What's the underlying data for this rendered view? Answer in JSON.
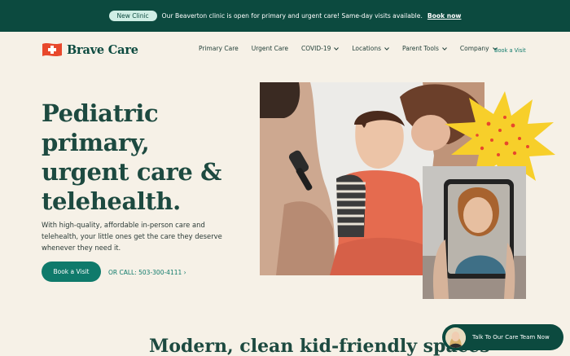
{
  "announcement": {
    "badge": "New Clinic",
    "text": "Our Beaverton clinic is open for primary and urgent care! Same-day visits available.",
    "link": "Book now"
  },
  "brand": {
    "name": "Brave Care"
  },
  "nav": {
    "items": [
      {
        "label": "Primary Care",
        "has_dropdown": false
      },
      {
        "label": "Urgent Care",
        "has_dropdown": false
      },
      {
        "label": "COVID-19",
        "has_dropdown": true
      },
      {
        "label": "Locations",
        "has_dropdown": true
      },
      {
        "label": "Parent Tools",
        "has_dropdown": true
      },
      {
        "label": "Company",
        "has_dropdown": true
      }
    ],
    "cta": "Book a Visit"
  },
  "hero": {
    "title_lines": [
      "Pediatric",
      "primary,",
      "urgent care &",
      "telehealth."
    ],
    "subtitle": "With high-quality, affordable in-person care and telehealth, your little ones get the care they deserve whenever they need it.",
    "primary_button": "Book a Visit",
    "call_link": "OR CALL: 503-300-4111 ›"
  },
  "section": {
    "heading": "Modern, clean kid-friendly spaces"
  },
  "chat": {
    "label": "Talk To Our Care Team Now"
  },
  "colors": {
    "dark_green": "#0c4a3f",
    "accent_teal": "#0f7a6b",
    "cream": "#f6f1e7",
    "logo_red": "#e8482c",
    "sun_yellow": "#f7cf2a"
  },
  "icons": [
    "flag-cross-logo",
    "chevron-down-icon",
    "sun-burst-decoration"
  ]
}
